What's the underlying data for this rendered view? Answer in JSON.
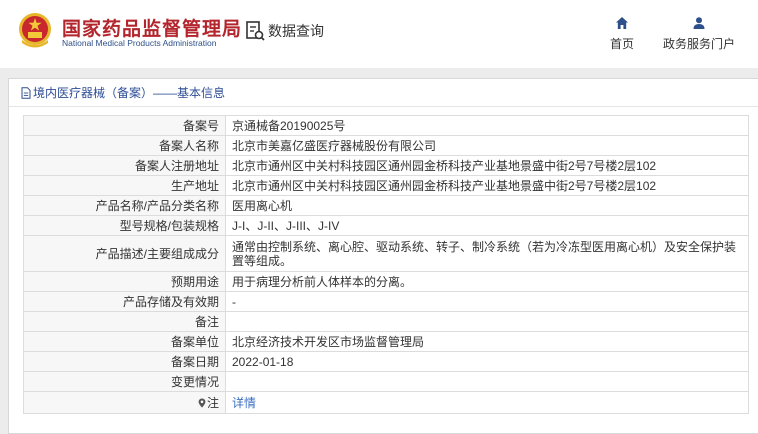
{
  "header": {
    "logo_cn": "国家药品监督管理局",
    "logo_en": "National Medical Products Administration",
    "query_label": "数据查询",
    "nav": [
      {
        "icon": "home-icon",
        "label": "首页"
      },
      {
        "icon": "user-icon",
        "label": "政务服务门户"
      }
    ]
  },
  "breadcrumb": "境内医疗器械（备案）——基本信息",
  "colors": {
    "brand_red": "#b3252c",
    "nav_blue": "#2d4f8a",
    "link_blue": "#3a6fc4",
    "band_gray": "#ececec"
  },
  "rows": [
    {
      "label": "备案号",
      "value": "京通械备20190025号"
    },
    {
      "label": "备案人名称",
      "value": "北京市美嘉亿盛医疗器械股份有限公司"
    },
    {
      "label": "备案人注册地址",
      "value": "北京市通州区中关村科技园区通州园金桥科技产业基地景盛中街2号7号楼2层102"
    },
    {
      "label": "生产地址",
      "value": "北京市通州区中关村科技园区通州园金桥科技产业基地景盛中街2号7号楼2层102"
    },
    {
      "label": "产品名称/产品分类名称",
      "value": "医用离心机"
    },
    {
      "label": "型号规格/包装规格",
      "value": "J-I、J-II、J-III、J-IV"
    },
    {
      "label": "产品描述/主要组成成分",
      "value": "通常由控制系统、离心腔、驱动系统、转子、制冷系统（若为冷冻型医用离心机）及安全保护装置等组成。"
    },
    {
      "label": "预期用途",
      "value": "用于病理分析前人体样本的分离。"
    },
    {
      "label": "产品存储及有效期",
      "value": "-"
    },
    {
      "label": "备注",
      "value": ""
    },
    {
      "label": "备案单位",
      "value": "北京经济技术开发区市场监督管理局"
    },
    {
      "label": "备案日期",
      "value": "2022-01-18"
    },
    {
      "label": "变更情况",
      "value": ""
    }
  ],
  "note_row": {
    "label": "注",
    "link": "详情"
  }
}
